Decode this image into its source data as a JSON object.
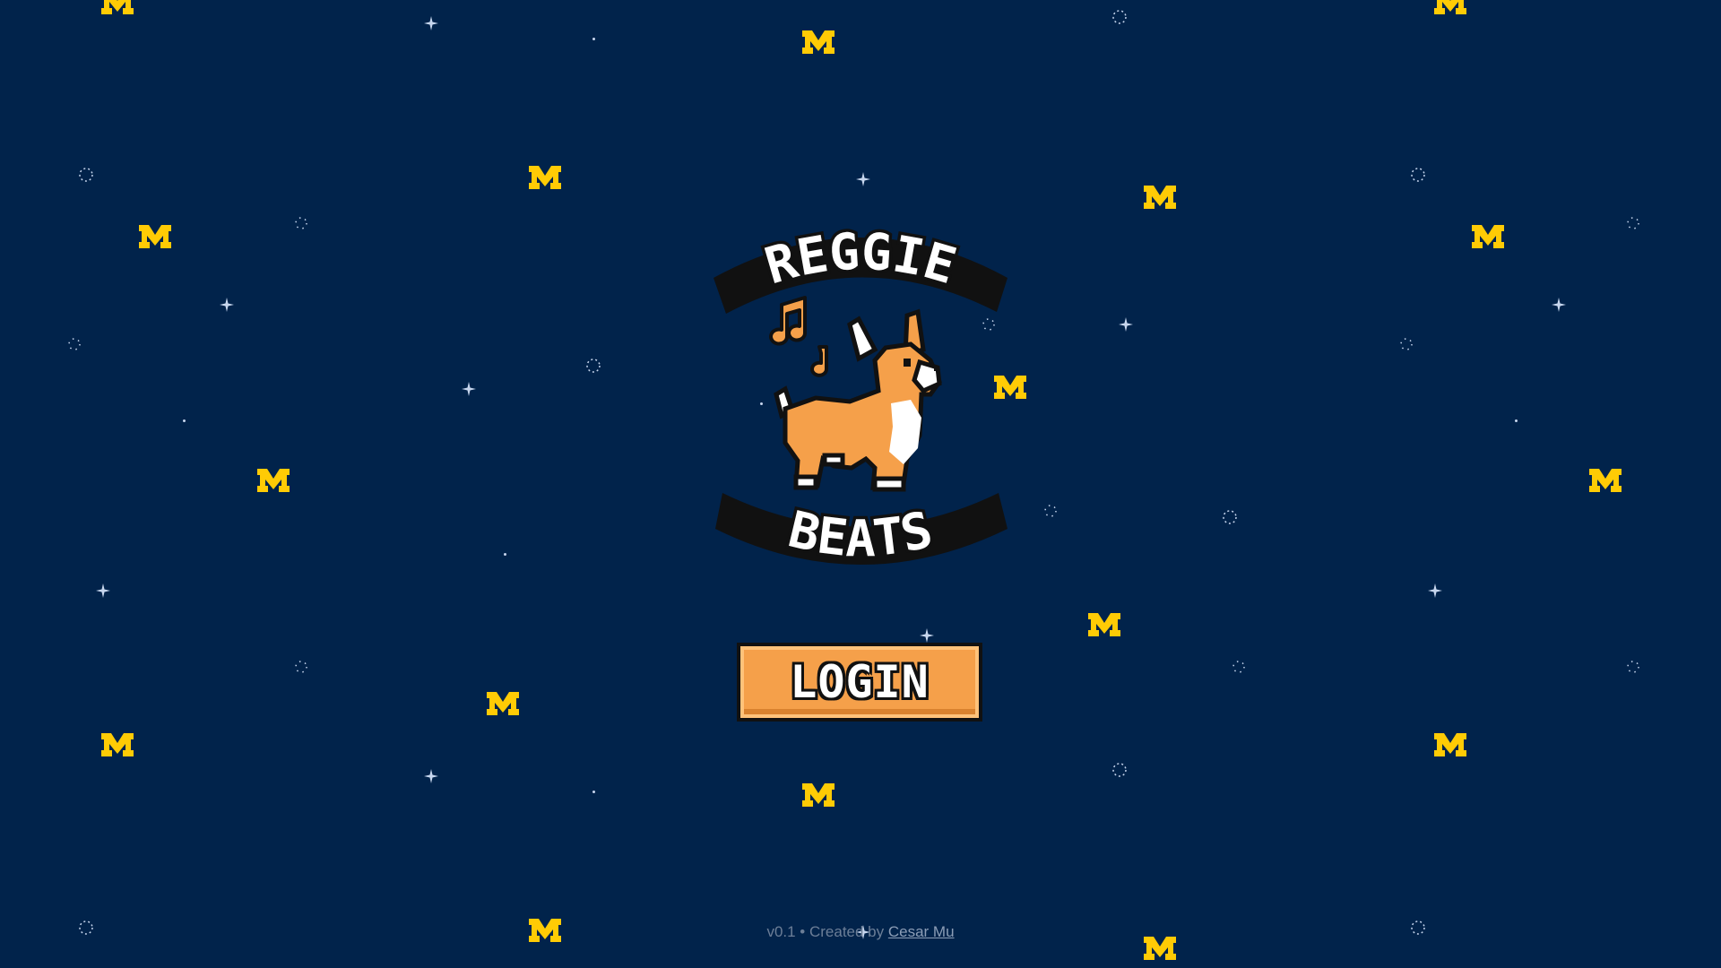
{
  "app": {
    "title_top": "REGGIE",
    "title_bottom": "BEATS"
  },
  "login": {
    "label": "LOGIN"
  },
  "footer": {
    "prefix": "v0.1 • Created by",
    "author": "Cesar Mu"
  },
  "colors": {
    "background": "#01234b",
    "maize": "#ffcb05",
    "button": "#f5a04a",
    "star": "#c7d6ee"
  },
  "icons": {
    "background_logo": "block-m-icon",
    "mascot": "corgi-icon",
    "notes": "music-note-icon"
  }
}
